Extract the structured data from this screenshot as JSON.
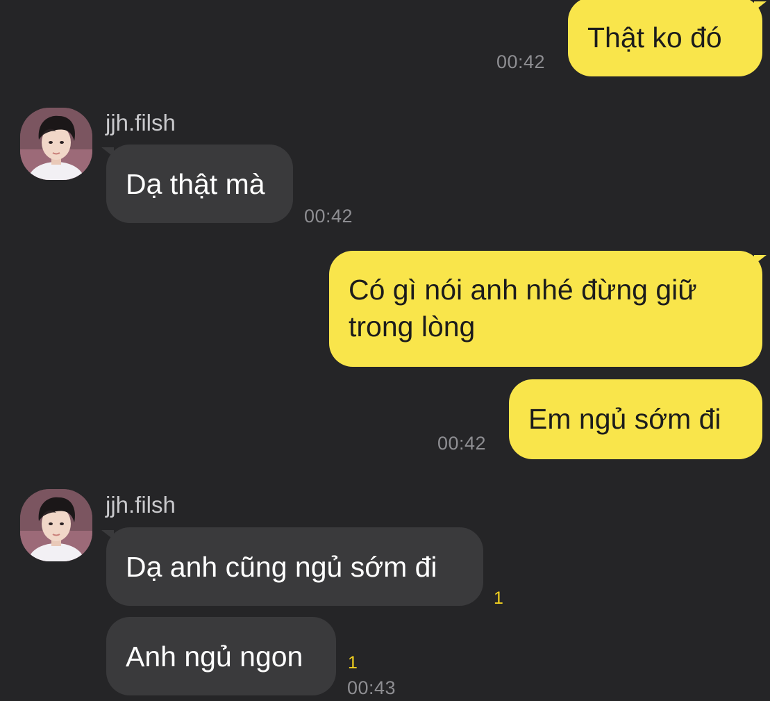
{
  "messages": [
    {
      "id": "m1",
      "direction": "outgoing",
      "text": "Thật ko đó",
      "time": "00:42"
    },
    {
      "id": "m2",
      "direction": "incoming",
      "sender": "jjh.filsh",
      "text": "Dạ thật mà",
      "time": "00:42"
    },
    {
      "id": "m3",
      "direction": "outgoing",
      "text": "Có gì nói anh nhé đừng giữ trong lòng"
    },
    {
      "id": "m4",
      "direction": "outgoing",
      "text": "Em ngủ sớm đi",
      "time": "00:42"
    },
    {
      "id": "m5",
      "direction": "incoming",
      "sender": "jjh.filsh",
      "text": "Dạ anh cũng ngủ sớm đi",
      "unread": "1"
    },
    {
      "id": "m6",
      "direction": "incoming",
      "text": "Anh ngủ ngon",
      "unread": "1",
      "time": "00:43"
    }
  ],
  "colors": {
    "background": "#252527",
    "outgoing_bubble": "#f9e54b",
    "incoming_bubble": "#3a3a3c",
    "timestamp": "#8e8e92",
    "unread_count": "#f4d21f"
  },
  "icons": {
    "avatar": "profile-photo-avatar"
  }
}
